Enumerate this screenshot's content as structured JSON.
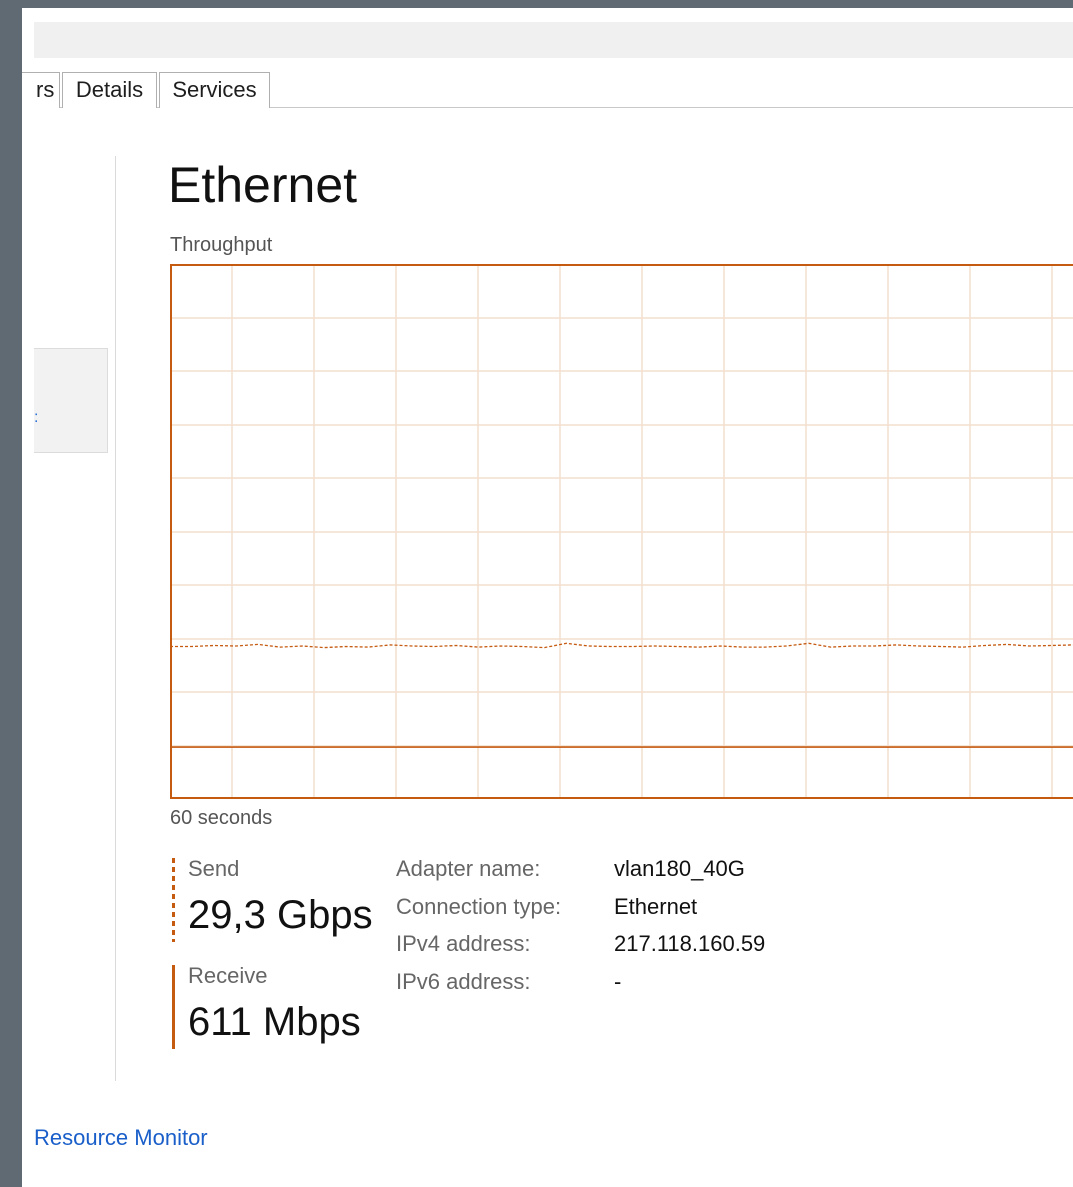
{
  "tabs": [
    {
      "label": "rs"
    },
    {
      "label": "Details"
    },
    {
      "label": "Services"
    }
  ],
  "header": {
    "title": "Ethernet"
  },
  "graph": {
    "label": "Throughput",
    "time_label": "60 seconds",
    "line_color": "#c55a11",
    "grid_color": "#f3dfcf"
  },
  "send": {
    "label": "Send",
    "value": "29,3 Gbps"
  },
  "receive": {
    "label": "Receive",
    "value": "611 Mbps"
  },
  "properties": [
    {
      "key": "Adapter name:",
      "value": "vlan180_40G"
    },
    {
      "key": "Connection type:",
      "value": "Ethernet"
    },
    {
      "key": "IPv4 address:",
      "value": "217.118.160.59"
    },
    {
      "key": "IPv6 address:",
      "value": "-"
    }
  ],
  "footer": {
    "link": "Resource Monitor"
  },
  "chart_data": {
    "type": "line",
    "title": "Throughput",
    "xlabel": "60 seconds",
    "ylabel": "",
    "xlim": [
      0,
      60
    ],
    "ylim": [
      0,
      1
    ],
    "series": [
      {
        "style": "dashed",
        "values": [
          0.285,
          0.285,
          0.287,
          0.286,
          0.289,
          0.284,
          0.286,
          0.283,
          0.285,
          0.284,
          0.288,
          0.286,
          0.285,
          0.287,
          0.284,
          0.286,
          0.285,
          0.283,
          0.291,
          0.286,
          0.285,
          0.285,
          0.286,
          0.285,
          0.284,
          0.286,
          0.284,
          0.284,
          0.286,
          0.291,
          0.284,
          0.286,
          0.286,
          0.288,
          0.286,
          0.285,
          0.284,
          0.287,
          0.289,
          0.286,
          0.287,
          0.288
        ]
      },
      {
        "style": "solid",
        "values": [
          0.097,
          0.097,
          0.097,
          0.097,
          0.097,
          0.097,
          0.097,
          0.097,
          0.097,
          0.097,
          0.097,
          0.097,
          0.097,
          0.097,
          0.097,
          0.097,
          0.097,
          0.097,
          0.097,
          0.097,
          0.097,
          0.097,
          0.097,
          0.097,
          0.097,
          0.097,
          0.097,
          0.097,
          0.097,
          0.097,
          0.097,
          0.097,
          0.097,
          0.097,
          0.097,
          0.097,
          0.097,
          0.097,
          0.097,
          0.097,
          0.097,
          0.097
        ]
      }
    ],
    "grid": true
  }
}
